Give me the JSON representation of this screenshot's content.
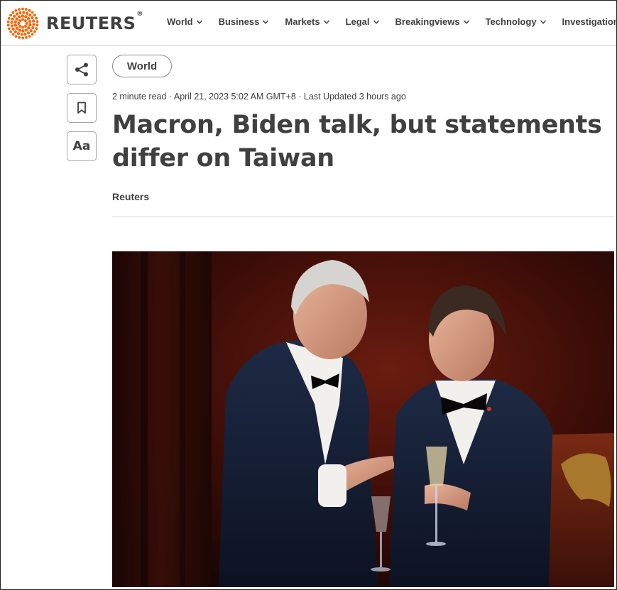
{
  "brand": {
    "name": "REUTERS",
    "registered_mark": "®",
    "accent_color": "#fa6400"
  },
  "nav": {
    "items": [
      {
        "label": "World",
        "has_dropdown": true
      },
      {
        "label": "Business",
        "has_dropdown": true
      },
      {
        "label": "Markets",
        "has_dropdown": true
      },
      {
        "label": "Legal",
        "has_dropdown": true
      },
      {
        "label": "Breakingviews",
        "has_dropdown": true
      },
      {
        "label": "Technology",
        "has_dropdown": true
      },
      {
        "label": "Investigations",
        "has_dropdown": false
      }
    ]
  },
  "tools": {
    "share_icon": "share-icon",
    "bookmark_icon": "bookmark-icon",
    "text_size_label": "Aa"
  },
  "article": {
    "section": "World",
    "meta": "2 minute read · April 21, 2023 5:02 AM GMT+8 · Last Updated 3 hours ago",
    "headline": "Macron, Biden talk, but statements differ on Taiwan",
    "byline": "Reuters"
  }
}
